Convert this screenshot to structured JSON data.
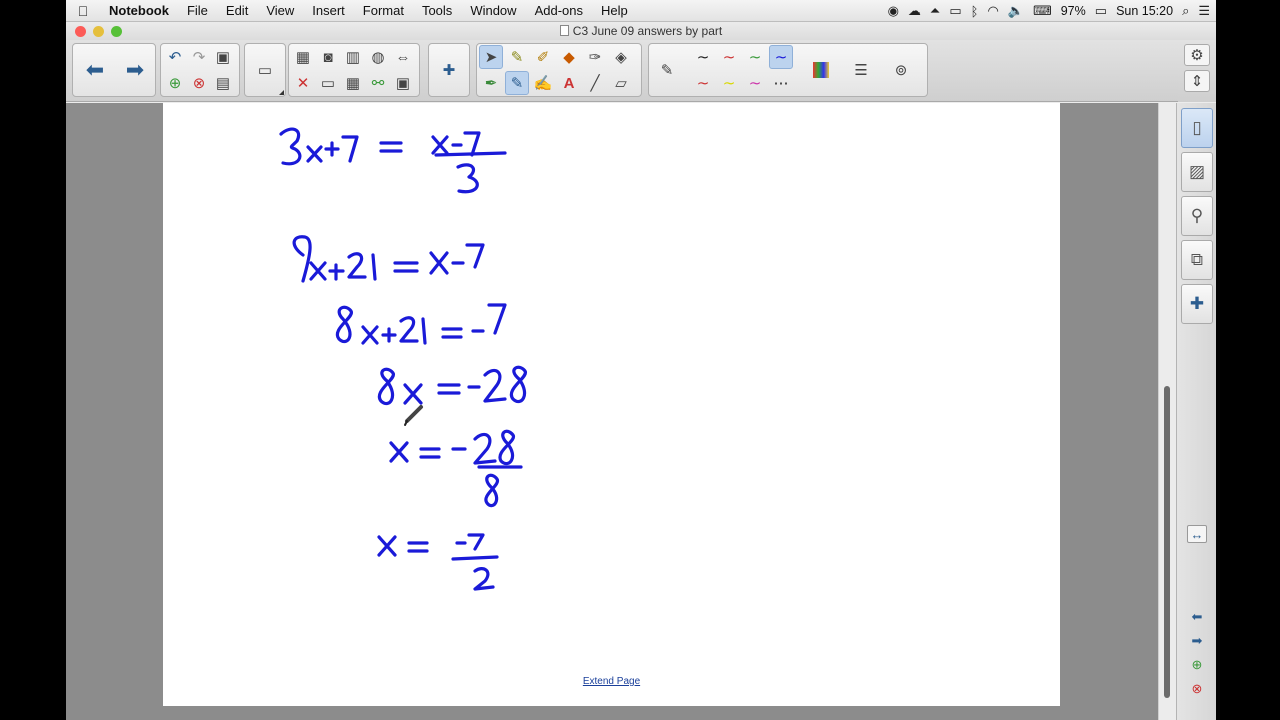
{
  "menubar": {
    "apple": "",
    "app_name": "Notebook",
    "menus": [
      "File",
      "Edit",
      "View",
      "Insert",
      "Format",
      "Tools",
      "Window",
      "Add-ons",
      "Help"
    ],
    "battery": "97%",
    "clock": "Sun 15:20"
  },
  "window": {
    "title": "C3 June 09 answers by part",
    "lights": {
      "close": "#fc5b57",
      "minimize": "#e5bf3c",
      "zoom": "#57c038"
    }
  },
  "toolbar": {
    "back_icon": "⬅",
    "forward_icon": "➡",
    "undo_icon": "↶",
    "redo_icon": "↷",
    "icons": [
      "arrow-left-icon",
      "arrow-right-icon",
      "undo-icon",
      "redo-icon",
      "insert-page-icon",
      "delete-page-icon",
      "save-icon",
      "screen-shade-icon",
      "paste-icon",
      "camera-icon",
      "document-camera-icon",
      "globe-icon",
      "resize-icon",
      "delete-icon",
      "table-icon",
      "link-icon",
      "fullscreen-icon",
      "addons-icon",
      "select-icon",
      "pen-icon",
      "highlighter-icon",
      "shape-icon",
      "magic-pen-icon",
      "creative-pen-icon",
      "calligraphy-pen-icon",
      "fill-icon",
      "text-icon",
      "line-icon",
      "eraser-icon",
      "pen-tool-icon",
      "color-palette-icon",
      "properties-icon",
      "link-tool-icon"
    ]
  },
  "page": {
    "extend_link": "Extend Page"
  },
  "ink_color": "#1a1ad8",
  "sidebar": {
    "tabs": [
      "page-sorter-icon",
      "gallery-icon",
      "attachments-icon",
      "properties-icon",
      "addons-icon"
    ]
  }
}
